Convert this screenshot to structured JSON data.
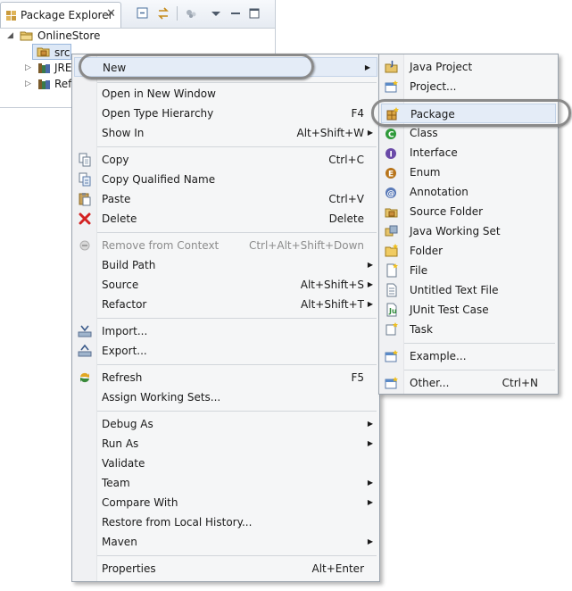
{
  "explorer": {
    "tab_title": "Package Explorer",
    "tree": [
      {
        "label": "OnlineStore",
        "icon": "project-icon",
        "expanded": true
      },
      {
        "label": "src",
        "icon": "source-folder-icon",
        "selected": true
      },
      {
        "label": "JRE",
        "icon": "library-icon"
      },
      {
        "label": "Ref",
        "icon": "library-icon"
      }
    ]
  },
  "context_menu": {
    "items": [
      {
        "label": "New",
        "submenu": true,
        "highlighted": true
      },
      {
        "label": "Open in New Window"
      },
      {
        "label": "Open Type Hierarchy",
        "shortcut": "F4"
      },
      {
        "label": "Show In",
        "shortcut": "Alt+Shift+W",
        "submenu": true
      },
      {
        "label": "Copy",
        "shortcut": "Ctrl+C",
        "icon": "copy-icon"
      },
      {
        "label": "Copy Qualified Name",
        "icon": "copy-qualified-icon"
      },
      {
        "label": "Paste",
        "shortcut": "Ctrl+V",
        "icon": "paste-icon"
      },
      {
        "label": "Delete",
        "shortcut": "Delete",
        "icon": "delete-icon"
      },
      {
        "label": "Remove from Context",
        "shortcut": "Ctrl+Alt+Shift+Down",
        "disabled": true,
        "icon": "remove-context-icon"
      },
      {
        "label": "Build Path",
        "submenu": true
      },
      {
        "label": "Source",
        "shortcut": "Alt+Shift+S",
        "submenu": true
      },
      {
        "label": "Refactor",
        "shortcut": "Alt+Shift+T",
        "submenu": true
      },
      {
        "label": "Import...",
        "icon": "import-icon"
      },
      {
        "label": "Export...",
        "icon": "export-icon"
      },
      {
        "label": "Refresh",
        "shortcut": "F5",
        "icon": "refresh-icon"
      },
      {
        "label": "Assign Working Sets..."
      },
      {
        "label": "Debug As",
        "submenu": true
      },
      {
        "label": "Run As",
        "submenu": true
      },
      {
        "label": "Validate"
      },
      {
        "label": "Team",
        "submenu": true
      },
      {
        "label": "Compare With",
        "submenu": true
      },
      {
        "label": "Restore from Local History..."
      },
      {
        "label": "Maven",
        "submenu": true
      },
      {
        "label": "Properties",
        "shortcut": "Alt+Enter"
      }
    ]
  },
  "new_submenu": {
    "items": [
      {
        "label": "Java Project",
        "icon": "java-project-icon"
      },
      {
        "label": "Project...",
        "icon": "project-wizard-icon"
      },
      {
        "label": "Package",
        "icon": "package-icon",
        "highlighted": true
      },
      {
        "label": "Class",
        "icon": "class-icon"
      },
      {
        "label": "Interface",
        "icon": "interface-icon"
      },
      {
        "label": "Enum",
        "icon": "enum-icon"
      },
      {
        "label": "Annotation",
        "icon": "annotation-icon"
      },
      {
        "label": "Source Folder",
        "icon": "new-source-folder-icon"
      },
      {
        "label": "Java Working Set",
        "icon": "working-set-icon"
      },
      {
        "label": "Folder",
        "icon": "folder-icon"
      },
      {
        "label": "File",
        "icon": "file-icon"
      },
      {
        "label": "Untitled Text File",
        "icon": "text-file-icon"
      },
      {
        "label": "JUnit Test Case",
        "icon": "junit-icon"
      },
      {
        "label": "Task",
        "icon": "task-icon"
      },
      {
        "label": "Example...",
        "icon": "example-icon"
      },
      {
        "label": "Other...",
        "shortcut": "Ctrl+N",
        "icon": "other-wizard-icon"
      }
    ]
  },
  "colors": {
    "highlight": "#e4ecf7",
    "callout": "#8a8a8a",
    "menu_bg": "#f5f6f7"
  }
}
